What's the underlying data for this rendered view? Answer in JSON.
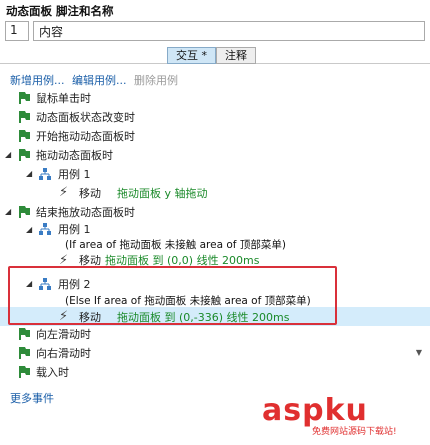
{
  "panel": {
    "title": "动态面板 脚注和名称",
    "index_value": "1",
    "name_value": "内容"
  },
  "tabs": [
    {
      "label": "交互 *",
      "active": true
    },
    {
      "label": "注释",
      "active": false
    }
  ],
  "case_links": {
    "new": "新增用例...",
    "edit": "编辑用例...",
    "delete": "删除用例"
  },
  "events": {
    "e1": "鼠标单击时",
    "e2": "动态面板状态改变时",
    "e3": "开始拖动动态面板时",
    "e4": "拖动动态面板时",
    "e4_case1": "用例 1",
    "e4_case1_action": "移动",
    "e4_case1_target": "拖动面板 y 轴拖动",
    "e5": "结束拖放动态面板时",
    "e5_case1": "用例 1",
    "e5_case1_cond": "(If area of 拖动面板 未接触 area of 顶部菜单)",
    "e5_case1_action": "移动",
    "e5_case1_target": "拖动面板 到 (0,0) 线性 200ms",
    "e5_case2": "用例 2",
    "e5_case2_cond": "(Else If area of 拖动面板 未接触 area of 顶部菜单)",
    "e5_case2_action": "移动",
    "e5_case2_target": "拖动面板 到 (0,-336) 线性 200ms",
    "e6": "向左滑动时",
    "e7": "向右滑动时",
    "e8": "载入时"
  },
  "more_events": "更多事件",
  "watermark": {
    "brand": "aspku",
    "sub": "免费网站源码下载站!"
  },
  "icons": {
    "event": "event-flag-icon",
    "case": "case-branch-icon",
    "action": "lightning-icon"
  },
  "colors": {
    "link": "#1a5ea8",
    "green_text": "#1b8a2a",
    "selection": "#d4ecfb",
    "highlight_box": "#d9303a",
    "event_icon": "#2e8b3a"
  }
}
